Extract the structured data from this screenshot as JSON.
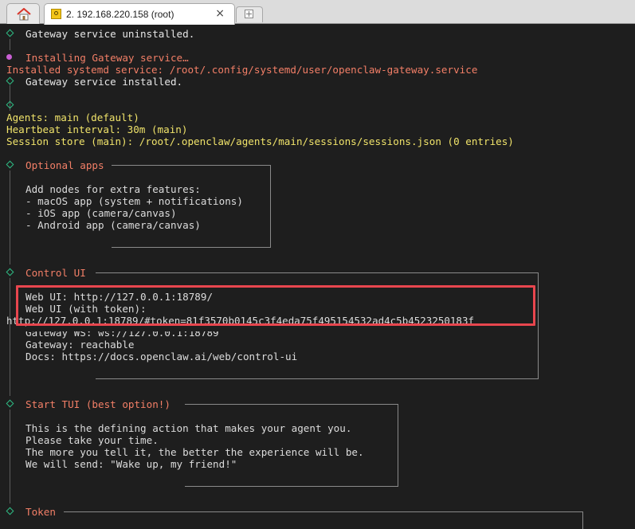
{
  "tabs": {
    "home_icon": "home-icon",
    "session_label": "2. 192.168.220.158 (root)",
    "close_glyph": "×",
    "new_tab_icon": "plus-icon"
  },
  "terminal": {
    "gateway_uninstalled": "Gateway service uninstalled.",
    "installing": "Installing Gateway service…",
    "installed_path": "Installed systemd service: /root/.config/systemd/user/openclaw-gateway.service",
    "gateway_installed": "Gateway service installed.",
    "agents": "Agents: main (default)",
    "heartbeat": "Heartbeat interval: 30m (main)",
    "session_store": "Session store (main): /root/.openclaw/agents/main/sessions/sessions.json (0 entries)",
    "optional_apps": {
      "title": "Optional apps",
      "lines": [
        "Add nodes for extra features:",
        "- macOS app (system + notifications)",
        "- iOS app (camera/canvas)",
        "- Android app (camera/canvas)"
      ]
    },
    "control_ui": {
      "title": "Control UI",
      "web_ui": "Web UI: http://127.0.0.1:18789/",
      "web_ui_token_label": "Web UI (with token):",
      "web_ui_token_url": "http://127.0.0.1:18789/#token=81f3570b0145c3f4eda75f495154532ad4c5b4523250183f",
      "gateway_ws": "Gateway WS: ws://127.0.0.1:18789",
      "gateway_status": "Gateway: reachable",
      "docs": "Docs: https://docs.openclaw.ai/web/control-ui"
    },
    "start_tui": {
      "title": "Start TUI (best option!)",
      "lines": [
        "This is the defining action that makes your agent you.",
        "Please take your time.",
        "The more you tell it, the better the experience will be.",
        "We will send: \"Wake up, my friend!\""
      ]
    },
    "token": {
      "title": "Token"
    }
  },
  "colors": {
    "background": "#1e1e1e",
    "yellow_text": "#f0e36a",
    "orange_text": "#f37f67",
    "gutter_green": "#2fbf86",
    "spinner_magenta": "#c95fd4",
    "highlight_red": "#e8464e"
  }
}
